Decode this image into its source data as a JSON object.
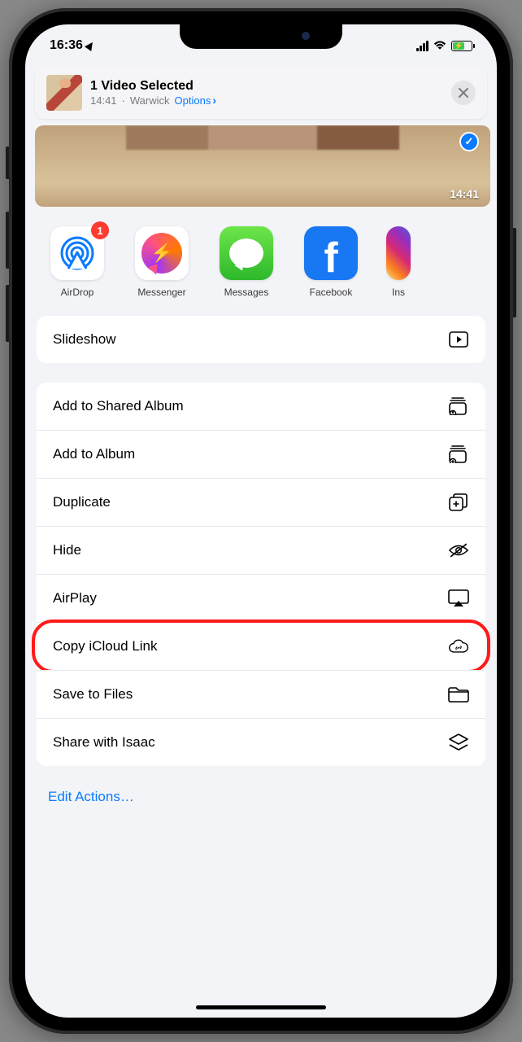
{
  "status": {
    "time": "16:36"
  },
  "header": {
    "title": "1 Video Selected",
    "time": "14:41",
    "separator": "·",
    "location": "Warwick",
    "options_label": "Options"
  },
  "preview": {
    "timestamp": "14:41"
  },
  "apps": {
    "airdrop": {
      "label": "AirDrop",
      "badge": "1"
    },
    "messenger": {
      "label": "Messenger"
    },
    "messages": {
      "label": "Messages"
    },
    "facebook": {
      "label": "Facebook"
    },
    "instagram": {
      "label": "Ins"
    }
  },
  "actions": {
    "slideshow": "Slideshow",
    "add_shared_album": "Add to Shared Album",
    "add_album": "Add to Album",
    "duplicate": "Duplicate",
    "hide": "Hide",
    "airplay": "AirPlay",
    "copy_icloud": "Copy iCloud Link",
    "save_files": "Save to Files",
    "share_isaac": "Share with Isaac"
  },
  "edit_actions": "Edit Actions…"
}
